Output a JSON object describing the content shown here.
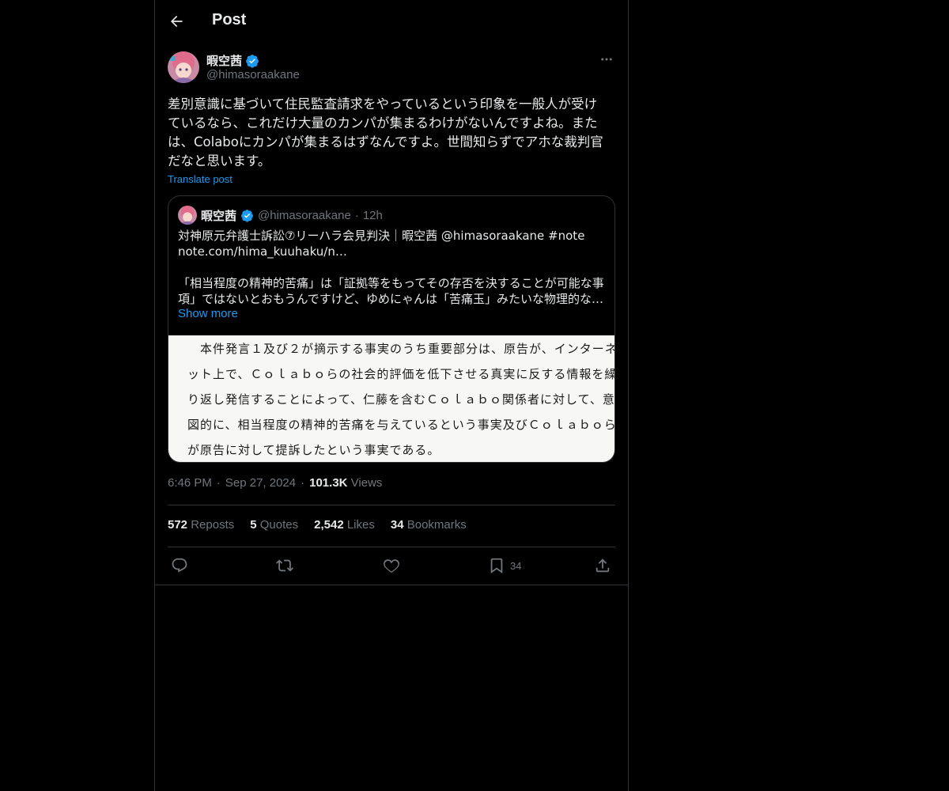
{
  "header": {
    "title": "Post"
  },
  "post": {
    "author": {
      "name": "暇空茜",
      "handle": "@himasoraakane",
      "verified": true
    },
    "text": "差別意識に基づいて住民監査請求をやっているという印象を一般人が受け\nているなら、これだけ大量のカンパが集まるわけがないんですよね。また\nは、Colaboにカンパが集まるはずなんですよ。世間知らずでアホな裁判官\nだなと思います。",
    "translate_label": "Translate post",
    "time": "6:46 PM",
    "date": "Sep 27, 2024",
    "views_count": "101.3K",
    "views_label": "Views"
  },
  "quote": {
    "author": {
      "name": "暇空茜",
      "handle": "@himasoraakane",
      "time": "12h"
    },
    "lines": [
      "対神原元弁護士訴訟⑦リーハラ会見判決｜暇空茜 @himasoraakane #note",
      "note.com/hima_kuuhaku/n…",
      "",
      "「相当程度の精神的苦痛」は「証拠等をもってその存否を決することが可能な事",
      "項」ではないとおもうんですけど、ゆめにゃんは「苦痛玉」みたいな物理的な…"
    ],
    "show_more": "Show more",
    "image_lines": [
      "本件発言１及び２が摘示する事実のうち重要部分は、原告が、インターネ",
      "ット上で、Ｃｏｌａｂｏらの社会的評価を低下させる真実に反する情報を繰",
      "り返し発信することによって、仁藤を含むＣｏｌａｂｏ関係者に対して、意",
      "図的に、相当程度の精神的苦痛を与えているという事実及びＣｏｌａｂｏら",
      "が原告に対して提訴したという事実である。"
    ]
  },
  "stats": {
    "reposts": {
      "count": "572",
      "label": "Reposts"
    },
    "quotes": {
      "count": "5",
      "label": "Quotes"
    },
    "likes": {
      "count": "2,542",
      "label": "Likes"
    },
    "bookmarks": {
      "count": "34",
      "label": "Bookmarks"
    }
  },
  "actions": {
    "reply_icon": "reply-icon",
    "repost_icon": "repost-icon",
    "like_icon": "like-icon",
    "bookmark_icon": "bookmark-icon",
    "bookmark_count": "34",
    "share_icon": "share-icon"
  },
  "colors": {
    "background": "#000000",
    "text": "#e7e9ea",
    "muted": "#71767b",
    "accent": "#1d9bf0",
    "border": "#2f3336"
  }
}
